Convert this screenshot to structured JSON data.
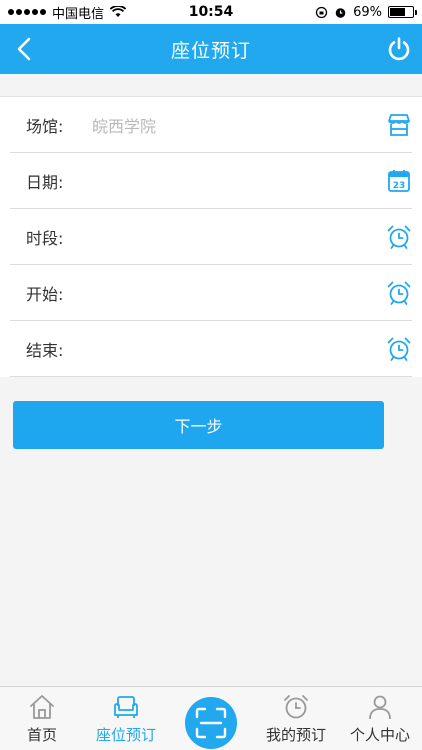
{
  "status_bar": {
    "carrier": "中国电信",
    "time": "10:54",
    "battery": "69%",
    "battery_level": 0.69
  },
  "nav": {
    "title": "座位预订"
  },
  "form": {
    "rows": [
      {
        "label": "场馆:",
        "value": "皖西学院",
        "icon": "storefront-icon"
      },
      {
        "label": "日期:",
        "value": "",
        "icon": "calendar-icon",
        "icon_text": "23"
      },
      {
        "label": "时段:",
        "value": "",
        "icon": "alarm-clock-icon"
      },
      {
        "label": "开始:",
        "value": "",
        "icon": "alarm-clock-icon"
      },
      {
        "label": "结束:",
        "value": "",
        "icon": "alarm-clock-icon"
      }
    ]
  },
  "next_button": {
    "label": "下一步"
  },
  "tabs": [
    {
      "label": "首页",
      "icon": "home-icon",
      "active": false
    },
    {
      "label": "座位预订",
      "icon": "sofa-icon",
      "active": true
    },
    {
      "label": "我的预订",
      "icon": "alarm-clock-icon",
      "active": false
    },
    {
      "label": "个人中心",
      "icon": "person-icon",
      "active": false
    }
  ],
  "colors": {
    "accent": "#21a8ee",
    "background": "#f4f4f4",
    "text": "#333333",
    "placeholder": "#b9b9b9"
  }
}
